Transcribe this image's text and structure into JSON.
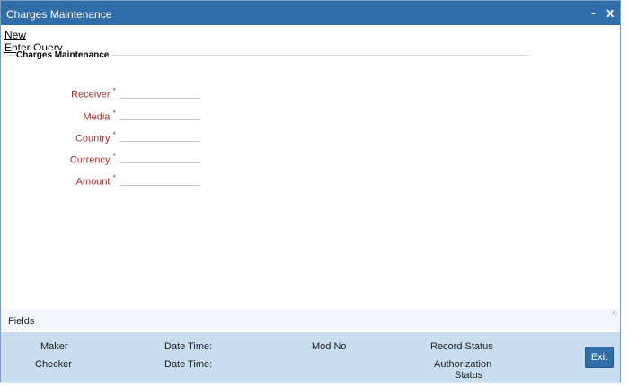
{
  "window": {
    "title": "Charges Maintenance",
    "minimize": "-",
    "close": "x"
  },
  "toolbar": {
    "new_label": "New",
    "enter_query_label": "Enter Query"
  },
  "section": {
    "legend": "Charges Maintenance"
  },
  "form": {
    "required_marker": "*",
    "fields": [
      {
        "label": "Receiver",
        "value": ""
      },
      {
        "label": "Media",
        "value": ""
      },
      {
        "label": "Country",
        "value": ""
      },
      {
        "label": "Currency",
        "value": ""
      },
      {
        "label": "Amount",
        "value": ""
      }
    ]
  },
  "fields_bar": {
    "label": "Fields",
    "caret": "^"
  },
  "audit": {
    "maker": "Maker",
    "checker": "Checker",
    "date_time_1": "Date Time:",
    "date_time_2": "Date Time:",
    "mod_no": "Mod No",
    "record_status": "Record Status",
    "authorization_status_line1": "Authorization",
    "authorization_status_line2": "Status"
  },
  "buttons": {
    "exit": "Exit"
  },
  "colors": {
    "titlebar": "#2f6ea8",
    "footer": "#c9ddf1",
    "label": "#a0312e"
  }
}
